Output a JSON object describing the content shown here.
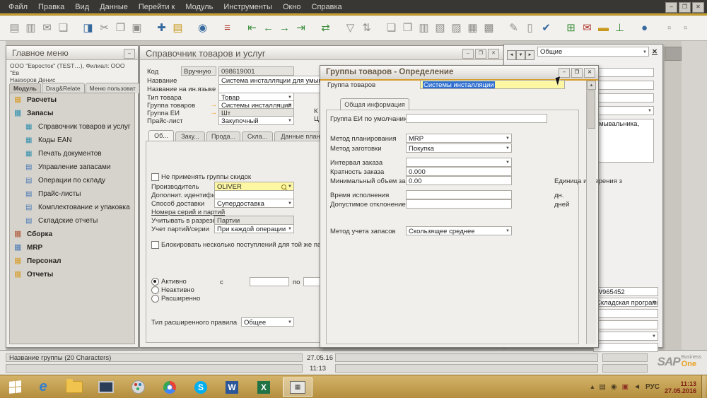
{
  "icons": {
    "minimize": "–",
    "restore": "❐",
    "close": "✕",
    "dropdown": "▼",
    "link_arrow": "→",
    "scroll_up": "▲",
    "nav_left": "◄",
    "nav_down": "▼",
    "nav_right": "►",
    "module": "▦",
    "doc": "▦",
    "folder": "▤",
    "tray_chevron": "▴",
    "tray_network": "▤",
    "tray_status": "◉",
    "tray_alert": "▣",
    "tray_volume": "◄",
    "ie": "e",
    "skype": "S",
    "word": "W",
    "excel": "X",
    "sap_window": "▦"
  },
  "menubar": {
    "items": [
      "Файл",
      "Правка",
      "Вид",
      "Данные",
      "Перейти к",
      "Модуль",
      "Инструменты",
      "Окно",
      "Справка"
    ]
  },
  "toolbar": {
    "icons": [
      "▤",
      "▥",
      "✉",
      "❏",
      "◨",
      "✂",
      "❐",
      "▣",
      "✚",
      "▤",
      "◉",
      "≡",
      "⇤",
      "←",
      "→",
      "⇥",
      "⇄",
      "▽",
      "⇅",
      "❏",
      "❐",
      "▥",
      "▧",
      "▨",
      "▦",
      "▩",
      "✎",
      "▯",
      "✔",
      "⊞",
      "✉",
      "▬",
      "⊥",
      "●",
      "▫",
      "▫"
    ]
  },
  "main_menu": {
    "title": "Главное меню",
    "company": "ООО \"Евросток\" (TEST…), Филиал: ООО \"Ев",
    "user": "Навзоров Денис",
    "tabs": [
      "Модуль",
      "Drag&Relate",
      "Меню пользоват"
    ],
    "items": [
      {
        "label": "Расчеты"
      },
      {
        "label": "Запасы"
      },
      {
        "label": "Справочник товаров и услуг"
      },
      {
        "label": "Коды EAN"
      },
      {
        "label": "Печать документов"
      },
      {
        "label": "Управление запасами"
      },
      {
        "label": "Операции по складу"
      },
      {
        "label": "Прайс-листы"
      },
      {
        "label": "Комплектование и упаковка"
      },
      {
        "label": "Складские отчеты"
      },
      {
        "label": "Сборка"
      },
      {
        "label": "MRP"
      },
      {
        "label": "Персонал"
      },
      {
        "label": "Отчеты"
      }
    ]
  },
  "item_master": {
    "title": "Справочник товаров и услуг",
    "code_label": "Код",
    "code_mode": "Вручную",
    "code_value": "098619001",
    "name_label": "Название",
    "name_value": "Система инсталляции для умывальника",
    "foreign_label": "Название на ин.языке",
    "foreign_value": "",
    "type_label": "Тип товара",
    "type_value": "Товар",
    "group_label": "Группа товаров",
    "group_value": "Системы инсталляции",
    "uom_label": "Группа ЕИ",
    "uom_value": "Шт",
    "price_label": "Прайс-лист",
    "price_value": "Закупочный",
    "clipped_label_1": "К",
    "clipped_label_2": "Ц",
    "tabs": [
      "Об...",
      "Заку...",
      "Прода...",
      "Скла...",
      "Данные планирова..."
    ],
    "general": {
      "discount_checkbox": "Не применять группы скидок",
      "manufacturer_label": "Производитель",
      "manufacturer_value": "OLIVER",
      "addid_label": "Дополнит. идентифик.",
      "addid_value": "",
      "shipping_label": "Способ доставки",
      "shipping_value": "Супердоставка",
      "serial_heading": "Номера серий и партий",
      "manageby_label": "Учитывать в разрезе",
      "manageby_value": "Партии",
      "method_label": "Учет партий/серии",
      "method_value": "При каждой операции",
      "block_checkbox": "Блокировать несколько поступлений для той же пар",
      "radio_active": "Активно",
      "radio_inactive": "Неактивно",
      "radio_advanced": "Расширенно",
      "from_label": "с",
      "to_label": "по",
      "from_value": "",
      "to_value": "",
      "rule_label": "Тип расширенного правила",
      "rule_value": "Общее"
    }
  },
  "group_dialog": {
    "title": "Группы товаров - Определение",
    "group_label": "Группа товаров",
    "group_value": "Системы инсталляции",
    "tab": "Общая информация",
    "rows": [
      {
        "label": "Группа ЕИ по умолчанию",
        "value": ""
      },
      {
        "label": "Метод планирования",
        "value": "MRP"
      },
      {
        "label": "Метод заготовки",
        "value": "Покупка"
      },
      {
        "label": "Интервал заказа",
        "value": ""
      },
      {
        "label": "Кратность заказа",
        "value": "0.000"
      },
      {
        "label": "Минимальный объем заказа",
        "value": "0.00",
        "suffix": "Единица измерения з"
      },
      {
        "label": "Время исполнения",
        "value": "",
        "suffix": "дн."
      },
      {
        "label": "Допустимое отклонение в д",
        "value": "",
        "suffix": "дней"
      },
      {
        "label": "Метод учета запасов",
        "value": "Скользящее среднее"
      }
    ]
  },
  "right_panel": {
    "selector": "Общие",
    "description": "Система инсталляции для умывальника, для фальш-стены",
    "rows": [
      {
        "value": "W965452"
      },
      {
        "value": "Складская программа"
      },
      {
        "value": ""
      },
      {
        "value": ""
      },
      {
        "value": ""
      },
      {
        "value": ""
      }
    ]
  },
  "status_bar": {
    "message": "Название группы (20 Characters)",
    "date": "27.05.16",
    "time": "11:13",
    "logo_sap": "SAP",
    "logo_business": "Business",
    "logo_one": "One"
  },
  "taskbar": {
    "language": "РУС",
    "time": "11:13",
    "date": "27.05.2016"
  }
}
